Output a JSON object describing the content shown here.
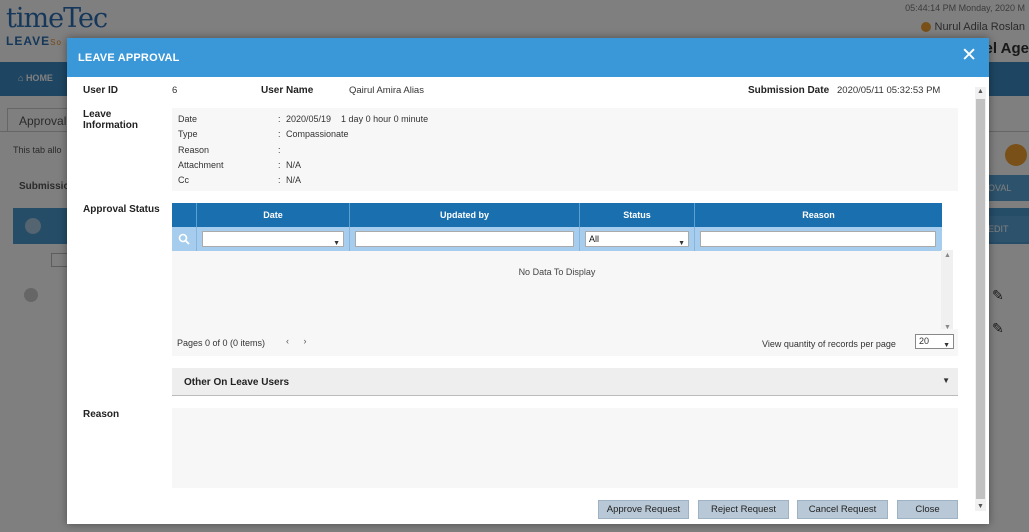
{
  "background": {
    "logo_main": "timeTec",
    "logo_sub": "LEAVE",
    "logo_sub2": "So",
    "datetime": "05:44:14 PM Monday, 2020 M",
    "user_name": "Nurul Adila Roslan",
    "page_title": "vel Age",
    "nav_home": "HOME",
    "tab_label": "Approval",
    "note_text": "This tab allo",
    "submission_label": "Submission",
    "right_btn1": "OVAL",
    "right_btn2": "EDIT"
  },
  "modal": {
    "title": "LEAVE APPROVAL",
    "close_symbol": "✕",
    "user_id_label": "User ID",
    "user_id_value": "6",
    "user_name_label": "User Name",
    "user_name_value": "Qairul Amira Alias",
    "submission_date_label": "Submission Date",
    "submission_date_value": "2020/05/11 05:32:53 PM",
    "leave_info_label_1": "Leave",
    "leave_info_label_2": "Information",
    "leave_info": [
      {
        "label": "Date",
        "value": "2020/05/19    1 day 0 hour 0 minute"
      },
      {
        "label": "Type",
        "value": "Compassionate"
      },
      {
        "label": "Reason",
        "value": ""
      },
      {
        "label": "Attachment",
        "value": "N/A"
      },
      {
        "label": "Cc",
        "value": "N/A"
      }
    ],
    "approval_status_label": "Approval Status",
    "grid": {
      "columns": [
        "Date",
        "Updated by",
        "Status",
        "Reason"
      ],
      "filter_status_value": "All",
      "no_data": "No Data To Display"
    },
    "pager": {
      "text": "Pages 0 of 0 (0 items)",
      "nav": "‹ ›",
      "qty_label": "View quantity of records per page",
      "qty_value": "20"
    },
    "accordion_title": "Other On Leave Users",
    "reason_label": "Reason",
    "buttons": {
      "approve": "Approve Request",
      "reject": "Reject Request",
      "cancel": "Cancel Request",
      "close": "Close"
    }
  }
}
